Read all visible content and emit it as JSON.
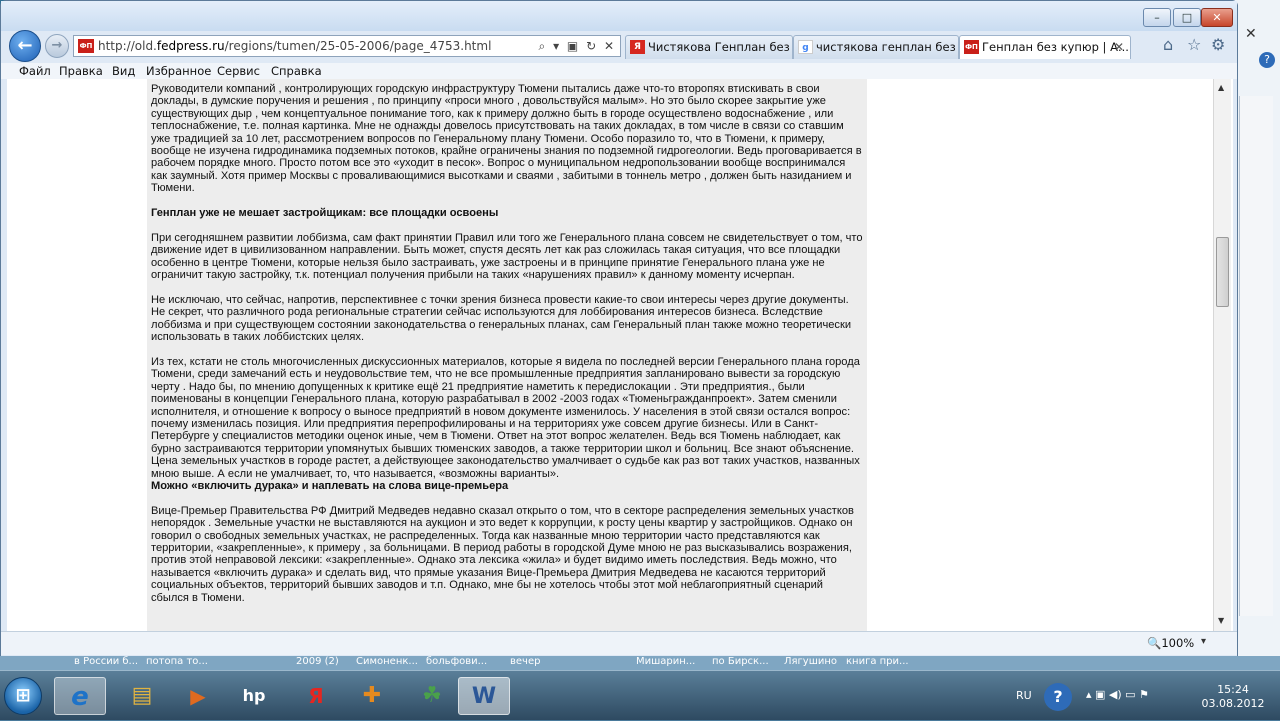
{
  "browser": {
    "url_prefix": "http://old.",
    "url_domain": "fedpress.ru",
    "url_path": "/regions/tumen/25-05-2006/page_4753.html",
    "address_tools": "⌕ ▾ ▣ ↻ ✕",
    "site_icon_text": "ФП",
    "tabs": [
      {
        "label": "Чистякова Генплан без к...",
        "icon_text": "Я",
        "icon_color": "#d6281f"
      },
      {
        "label": "чистякова генплан без ку...",
        "icon_text": "g",
        "icon_color": "#4285f4"
      },
      {
        "label": "Генплан без купюр | А...",
        "icon_text": "ФП",
        "icon_color": "#c9201a",
        "close": "✕"
      }
    ],
    "right_icons": [
      "⌂",
      "☆",
      "⚙"
    ],
    "window_buttons": {
      "min": "–",
      "max": "□",
      "close": "✕"
    },
    "menu": [
      "Файл",
      "Правка",
      "Вид",
      "Избранное",
      "Сервис",
      "Справка"
    ],
    "zoom": "100%",
    "zoom_arrow": "▾",
    "scroll_up": "▲",
    "scroll_down": "▼"
  },
  "article": {
    "p1": "Руководители компаний , контролирующих городскую инфраструктуру Тюмени пытались даже что-то второпях втискивать в свои доклады, в думские поручения и решения , по принципу «проси много , довольствуйся малым». Но это было скорее закрытие уже существующих дыр , чем концептуальное понимание того, как к примеру должно быть в городе осуществлено водоснабжение , или теплоснабжение, т.е. полная картинка. Мне не однажды довелось присутствовать на таких докладах, в том числе в связи со ставшим уже традицией за 10 лет, рассмотрением вопросов по Генеральному плану Тюмени. Особо поразило то, что в Тюмени, к примеру, вообще не изучена гидродинамика подземных потоков, крайне ограничены знания по подземной гидрогеологии. Ведь проговаривается в рабочем порядке много. Просто потом все это «уходит в песок». Вопрос о муниципальном недропользовании вообще воспринимался как заумный. Хотя пример Москвы с проваливающимися высотками и сваями , забитыми в тоннель метро , должен быть назиданием и Тюмени.",
    "h1": "Генплан уже не мешает застройщикам: все площадки освоены",
    "p2": "При сегодняшнем развитии лоббизма, сам факт принятии Правил или того же Генерального плана совсем не свидетельствует о том, что движение идет в цивилизованном направлении. Быть может, спустя десять лет как раз сложилась такая ситуация, что все площадки особенно в центре Тюмени, которые нельзя было застраивать, уже застроены и в принципе принятие Генерального плана уже не ограничит такую застройку, т.к. потенциал получения прибыли на таких «нарушениях правил» к данному моменту исчерпан.",
    "p3": "Не исключаю, что сейчас, напротив, перспективнее с точки зрения бизнеса провести какие-то свои интересы через другие документы. Не секрет, что различного рода региональные стратегии сейчас используются для лоббирования интересов бизнеса. Вследствие лоббизма и при существующем состоянии законодательства о генеральных планах, сам Генеральный план также можно теоретически использовать в таких лоббистских целях.",
    "p4": "Из тех, кстати не столь многочисленных дискуссионных материалов, которые я видела по последней версии Генерального плана города Тюмени, среди замечаний есть и неудовольствие тем, что не все промышленные предприятия запланировано вывести за городскую черту . Надо бы, по мнению допущенных к критике ещё 21 предприятие наметить к передислокации . Эти предприятия., были поименованы в концепции Генерального плана, которую разрабатывал в 2002 -2003 годах «Тюменьгражданпроект». Затем сменили исполнителя, и отношение к вопросу о выносе предприятий в новом документе изменилось. У населения в этой связи остался вопрос: почему изменилась позиция. Или предприятия перепрофилированы и на территориях уже совсем другие бизнесы. Или в Санкт-Петербурге у специалистов методики оценок иные, чем в Тюмени. Ответ на этот вопрос желателен. Ведь вся Тюмень наблюдает, как бурно застраиваются территории упомянутых бывших тюменских заводов, а также территории школ и больниц. Все знают объяснение. Цена земельных участков в городе растет, а действующее законодательство умалчивает о судьбе как раз вот таких участков, названных мною выше. А если не умалчивает, то, что называется, «возможны варианты».",
    "h2": "Можно «включить дурака» и наплевать на слова вице-премьера",
    "p5": "Вице-Премьер Правительства РФ Дмитрий Медведев недавно сказал открыто о том, что в секторе распределения земельных участков непорядок . Земельные участки не выставляются на аукцион и это ведет к коррупции, к росту цены квартир у застройщиков. Однако он говорил о свободных земельных участках, не распределенных. Тогда как названные мною территории часто представляются как территории, «закрепленные», к примеру , за больницами. В период работы в городской Думе мною не раз высказывались возражения, против этой неправовой лексики: «закрепленные». Однако эта лексика «жила» и будет видимо иметь последствия. Ведь можно, что называется «включить дурака» и сделать вид, что прямые указания Вице-Премьера Дмитрия Медведева не касаются территорий социальных объектов, территорий бывших заводов и т.п. Однако, мне бы не хотелось чтобы этот мой неблагоприятный сценарий сбылся в Тюмени."
  },
  "taskstrip": [
    "в России б...",
    "потопа то...",
    "2009 (2)",
    "Симоненк...",
    "больфови...",
    "вечер",
    "Мишарин...",
    "по Бирск...",
    "Лягушино",
    "книга при..."
  ],
  "taskbar": {
    "start_label": "⊞",
    "apps": [
      {
        "name": "ie",
        "label": "e",
        "color": "#1e73c8"
      },
      {
        "name": "explorer",
        "label": "▤",
        "color": "#e0b341"
      },
      {
        "name": "media",
        "label": "▶",
        "color": "#e06a1f"
      },
      {
        "name": "hp",
        "label": "hp",
        "color": "#1b1b1b"
      },
      {
        "name": "yandex",
        "label": "Я",
        "color": "#e52620"
      },
      {
        "name": "app6",
        "label": "✚",
        "color": "#e58a1f"
      },
      {
        "name": "app7",
        "label": "☘",
        "color": "#4aa14a"
      },
      {
        "name": "word",
        "label": "W",
        "color": "#2b5797"
      }
    ],
    "lang": "RU",
    "help": "?",
    "tray_icons": "▴ ▣ ◀) ▭ ⚑",
    "time": "15:24",
    "date": "03.08.2012"
  },
  "side_window": {
    "close": "✕",
    "help": "?"
  }
}
